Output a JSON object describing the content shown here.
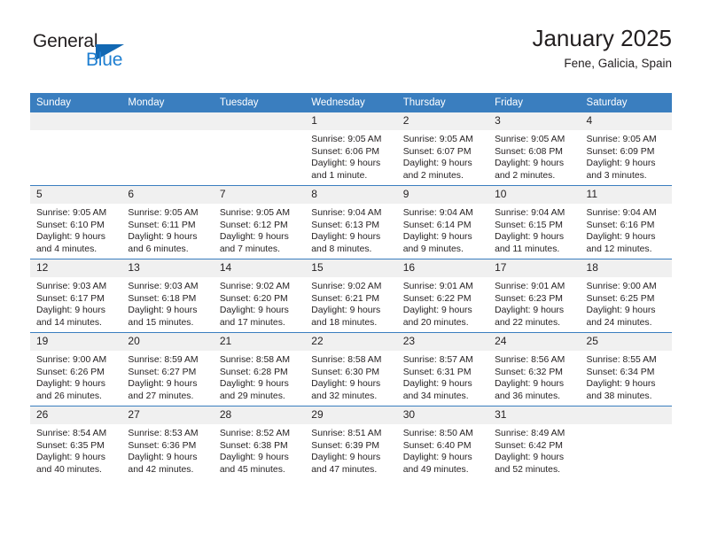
{
  "brand": {
    "line1": "General",
    "line2": "Blue",
    "triangle_color": "#1268b3",
    "blue_text_color": "#1f7fd1"
  },
  "header": {
    "title": "January 2025",
    "location": "Fene, Galicia, Spain"
  },
  "theme": {
    "header_bar": "#3a7ebf",
    "daynum_band": "#f0f0f0",
    "text": "#231f20"
  },
  "weekdays": [
    "Sunday",
    "Monday",
    "Tuesday",
    "Wednesday",
    "Thursday",
    "Friday",
    "Saturday"
  ],
  "weeks": [
    [
      {
        "day": "",
        "blank": true
      },
      {
        "day": "",
        "blank": true
      },
      {
        "day": "",
        "blank": true
      },
      {
        "day": "1",
        "sunrise": "Sunrise: 9:05 AM",
        "sunset": "Sunset: 6:06 PM",
        "daylight1": "Daylight: 9 hours",
        "daylight2": "and 1 minute."
      },
      {
        "day": "2",
        "sunrise": "Sunrise: 9:05 AM",
        "sunset": "Sunset: 6:07 PM",
        "daylight1": "Daylight: 9 hours",
        "daylight2": "and 2 minutes."
      },
      {
        "day": "3",
        "sunrise": "Sunrise: 9:05 AM",
        "sunset": "Sunset: 6:08 PM",
        "daylight1": "Daylight: 9 hours",
        "daylight2": "and 2 minutes."
      },
      {
        "day": "4",
        "sunrise": "Sunrise: 9:05 AM",
        "sunset": "Sunset: 6:09 PM",
        "daylight1": "Daylight: 9 hours",
        "daylight2": "and 3 minutes."
      }
    ],
    [
      {
        "day": "5",
        "sunrise": "Sunrise: 9:05 AM",
        "sunset": "Sunset: 6:10 PM",
        "daylight1": "Daylight: 9 hours",
        "daylight2": "and 4 minutes."
      },
      {
        "day": "6",
        "sunrise": "Sunrise: 9:05 AM",
        "sunset": "Sunset: 6:11 PM",
        "daylight1": "Daylight: 9 hours",
        "daylight2": "and 6 minutes."
      },
      {
        "day": "7",
        "sunrise": "Sunrise: 9:05 AM",
        "sunset": "Sunset: 6:12 PM",
        "daylight1": "Daylight: 9 hours",
        "daylight2": "and 7 minutes."
      },
      {
        "day": "8",
        "sunrise": "Sunrise: 9:04 AM",
        "sunset": "Sunset: 6:13 PM",
        "daylight1": "Daylight: 9 hours",
        "daylight2": "and 8 minutes."
      },
      {
        "day": "9",
        "sunrise": "Sunrise: 9:04 AM",
        "sunset": "Sunset: 6:14 PM",
        "daylight1": "Daylight: 9 hours",
        "daylight2": "and 9 minutes."
      },
      {
        "day": "10",
        "sunrise": "Sunrise: 9:04 AM",
        "sunset": "Sunset: 6:15 PM",
        "daylight1": "Daylight: 9 hours",
        "daylight2": "and 11 minutes."
      },
      {
        "day": "11",
        "sunrise": "Sunrise: 9:04 AM",
        "sunset": "Sunset: 6:16 PM",
        "daylight1": "Daylight: 9 hours",
        "daylight2": "and 12 minutes."
      }
    ],
    [
      {
        "day": "12",
        "sunrise": "Sunrise: 9:03 AM",
        "sunset": "Sunset: 6:17 PM",
        "daylight1": "Daylight: 9 hours",
        "daylight2": "and 14 minutes."
      },
      {
        "day": "13",
        "sunrise": "Sunrise: 9:03 AM",
        "sunset": "Sunset: 6:18 PM",
        "daylight1": "Daylight: 9 hours",
        "daylight2": "and 15 minutes."
      },
      {
        "day": "14",
        "sunrise": "Sunrise: 9:02 AM",
        "sunset": "Sunset: 6:20 PM",
        "daylight1": "Daylight: 9 hours",
        "daylight2": "and 17 minutes."
      },
      {
        "day": "15",
        "sunrise": "Sunrise: 9:02 AM",
        "sunset": "Sunset: 6:21 PM",
        "daylight1": "Daylight: 9 hours",
        "daylight2": "and 18 minutes."
      },
      {
        "day": "16",
        "sunrise": "Sunrise: 9:01 AM",
        "sunset": "Sunset: 6:22 PM",
        "daylight1": "Daylight: 9 hours",
        "daylight2": "and 20 minutes."
      },
      {
        "day": "17",
        "sunrise": "Sunrise: 9:01 AM",
        "sunset": "Sunset: 6:23 PM",
        "daylight1": "Daylight: 9 hours",
        "daylight2": "and 22 minutes."
      },
      {
        "day": "18",
        "sunrise": "Sunrise: 9:00 AM",
        "sunset": "Sunset: 6:25 PM",
        "daylight1": "Daylight: 9 hours",
        "daylight2": "and 24 minutes."
      }
    ],
    [
      {
        "day": "19",
        "sunrise": "Sunrise: 9:00 AM",
        "sunset": "Sunset: 6:26 PM",
        "daylight1": "Daylight: 9 hours",
        "daylight2": "and 26 minutes."
      },
      {
        "day": "20",
        "sunrise": "Sunrise: 8:59 AM",
        "sunset": "Sunset: 6:27 PM",
        "daylight1": "Daylight: 9 hours",
        "daylight2": "and 27 minutes."
      },
      {
        "day": "21",
        "sunrise": "Sunrise: 8:58 AM",
        "sunset": "Sunset: 6:28 PM",
        "daylight1": "Daylight: 9 hours",
        "daylight2": "and 29 minutes."
      },
      {
        "day": "22",
        "sunrise": "Sunrise: 8:58 AM",
        "sunset": "Sunset: 6:30 PM",
        "daylight1": "Daylight: 9 hours",
        "daylight2": "and 32 minutes."
      },
      {
        "day": "23",
        "sunrise": "Sunrise: 8:57 AM",
        "sunset": "Sunset: 6:31 PM",
        "daylight1": "Daylight: 9 hours",
        "daylight2": "and 34 minutes."
      },
      {
        "day": "24",
        "sunrise": "Sunrise: 8:56 AM",
        "sunset": "Sunset: 6:32 PM",
        "daylight1": "Daylight: 9 hours",
        "daylight2": "and 36 minutes."
      },
      {
        "day": "25",
        "sunrise": "Sunrise: 8:55 AM",
        "sunset": "Sunset: 6:34 PM",
        "daylight1": "Daylight: 9 hours",
        "daylight2": "and 38 minutes."
      }
    ],
    [
      {
        "day": "26",
        "sunrise": "Sunrise: 8:54 AM",
        "sunset": "Sunset: 6:35 PM",
        "daylight1": "Daylight: 9 hours",
        "daylight2": "and 40 minutes."
      },
      {
        "day": "27",
        "sunrise": "Sunrise: 8:53 AM",
        "sunset": "Sunset: 6:36 PM",
        "daylight1": "Daylight: 9 hours",
        "daylight2": "and 42 minutes."
      },
      {
        "day": "28",
        "sunrise": "Sunrise: 8:52 AM",
        "sunset": "Sunset: 6:38 PM",
        "daylight1": "Daylight: 9 hours",
        "daylight2": "and 45 minutes."
      },
      {
        "day": "29",
        "sunrise": "Sunrise: 8:51 AM",
        "sunset": "Sunset: 6:39 PM",
        "daylight1": "Daylight: 9 hours",
        "daylight2": "and 47 minutes."
      },
      {
        "day": "30",
        "sunrise": "Sunrise: 8:50 AM",
        "sunset": "Sunset: 6:40 PM",
        "daylight1": "Daylight: 9 hours",
        "daylight2": "and 49 minutes."
      },
      {
        "day": "31",
        "sunrise": "Sunrise: 8:49 AM",
        "sunset": "Sunset: 6:42 PM",
        "daylight1": "Daylight: 9 hours",
        "daylight2": "and 52 minutes."
      },
      {
        "day": "",
        "blank": true
      }
    ]
  ]
}
